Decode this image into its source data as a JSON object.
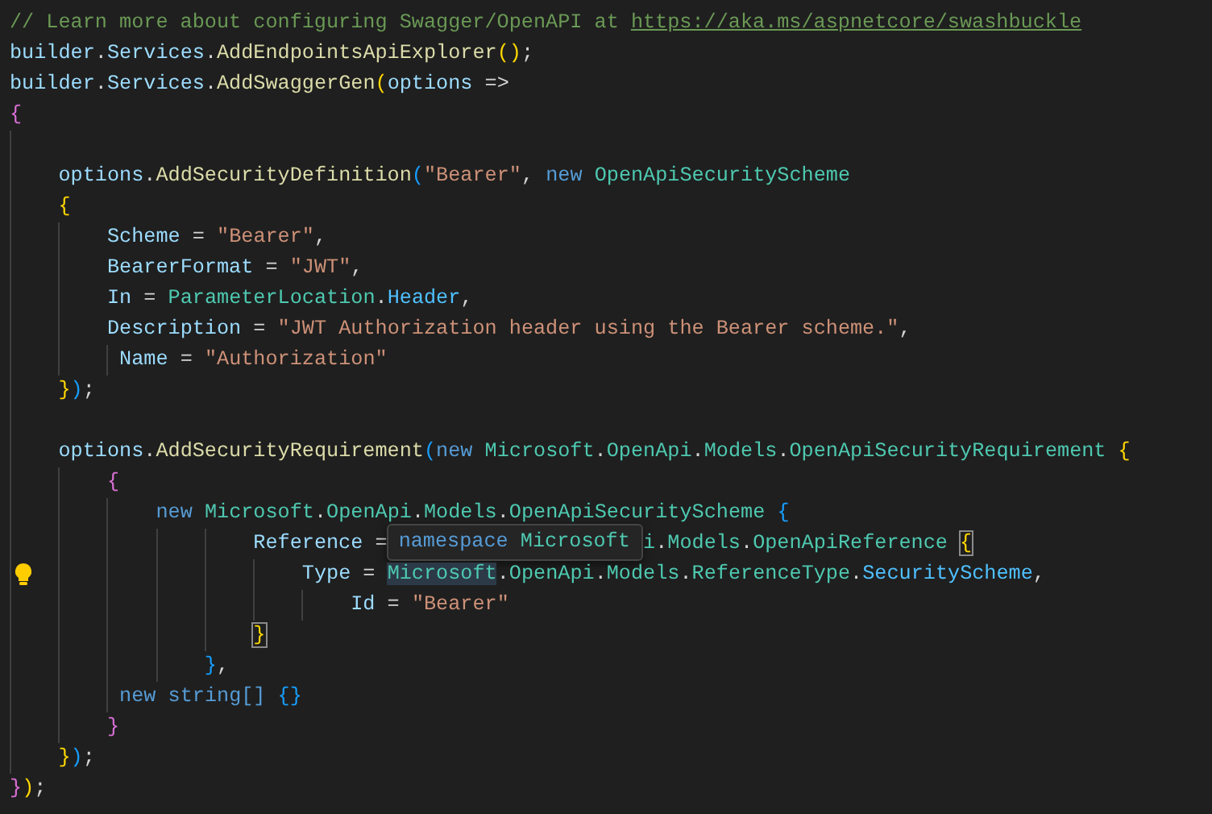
{
  "editor": {
    "lines": [
      {
        "kind": "code",
        "segments": [
          {
            "kind": "code",
            "tokens": [
              {
                "text": "// Learn more about configuring Swagger/OpenAPI at",
                "kind": "comment"
              }
            ]
          },
          {
            "kind": "link",
            "tokens": [
              {
                "text": "https://aka.ms/aspnetcore/swashbuckle",
                "kind": "link"
              }
            ]
          }
        ]
      },
      {
        "kind": "code",
        "segments": [
          {
            "kind": "code",
            "tokens": [
              {
                "text": "builder",
                "kind": "var"
              },
              {
                "text": ".",
                "kind": "p"
              },
              {
                "text": "Services",
                "kind": "var"
              },
              {
                "text": ".",
                "kind": "p"
              },
              {
                "text": "AddEndpointsApiExplorer",
                "kind": "fn"
              },
              {
                "text": "()",
                "kind": "b1"
              },
              {
                "text": ";",
                "kind": "p"
              }
            ]
          }
        ]
      },
      {
        "kind": "code",
        "segments": [
          {
            "kind": "code",
            "tokens": [
              {
                "text": "builder",
                "kind": "var"
              },
              {
                "text": ".",
                "kind": "p"
              },
              {
                "text": "Services",
                "kind": "var"
              },
              {
                "text": ".",
                "kind": "p"
              },
              {
                "text": "AddSwaggerGen",
                "kind": "fn"
              },
              {
                "text": "(",
                "kind": "b1"
              },
              {
                "text": "options",
                "kind": "var"
              },
              {
                "text": " =>",
                "kind": "p"
              }
            ]
          }
        ]
      },
      {
        "kind": "code",
        "segments": [
          {
            "kind": "code",
            "tokens": [
              {
                "text": "{",
                "kind": "b2"
              }
            ]
          }
        ]
      },
      {
        "kind": "blank"
      },
      {
        "kind": "code",
        "segments": [
          {
            "kind": "code",
            "tokens": [
              {
                "text": "    options",
                "kind": "var"
              },
              {
                "text": ".",
                "kind": "p"
              },
              {
                "text": "AddSecurityDefinition",
                "kind": "fn"
              },
              {
                "text": "(",
                "kind": "b3"
              },
              {
                "text": "\"Bearer\"",
                "kind": "str"
              },
              {
                "text": ", ",
                "kind": "p"
              },
              {
                "text": "new",
                "kind": "kw"
              },
              {
                "text": " OpenApiSecurityScheme",
                "kind": "type"
              }
            ]
          }
        ]
      },
      {
        "kind": "code",
        "segments": [
          {
            "kind": "code",
            "tokens": [
              {
                "text": "    {",
                "kind": "b1"
              }
            ]
          }
        ]
      },
      {
        "kind": "code",
        "segments": [
          {
            "kind": "code",
            "tokens": [
              {
                "text": "        Scheme",
                "kind": "var"
              },
              {
                "text": " = ",
                "kind": "p"
              },
              {
                "text": "\"Bearer\"",
                "kind": "str"
              },
              {
                "text": ",",
                "kind": "p"
              }
            ]
          }
        ]
      },
      {
        "kind": "code",
        "segments": [
          {
            "kind": "code",
            "tokens": [
              {
                "text": "        BearerFormat",
                "kind": "var"
              },
              {
                "text": " = ",
                "kind": "p"
              },
              {
                "text": "\"JWT\"",
                "kind": "str"
              },
              {
                "text": ",",
                "kind": "p"
              }
            ]
          }
        ]
      },
      {
        "kind": "code",
        "segments": [
          {
            "kind": "code",
            "tokens": [
              {
                "text": "        In",
                "kind": "var"
              },
              {
                "text": " = ",
                "kind": "p"
              },
              {
                "text": "ParameterLocation",
                "kind": "type"
              },
              {
                "text": ".",
                "kind": "p"
              },
              {
                "text": "Header",
                "kind": "enum"
              },
              {
                "text": ",",
                "kind": "p"
              }
            ]
          }
        ]
      },
      {
        "kind": "code",
        "segments": [
          {
            "kind": "code",
            "tokens": [
              {
                "text": "        Description",
                "kind": "var"
              },
              {
                "text": " = ",
                "kind": "p"
              },
              {
                "text": "\"JWT Authorization header using the Bearer scheme.\"",
                "kind": "str"
              },
              {
                "text": ",",
                "kind": "p"
              }
            ]
          }
        ]
      },
      {
        "kind": "code",
        "segments": [
          {
            "kind": "code",
            "tokens": [
              {
                "text": "         Name",
                "kind": "var"
              },
              {
                "text": " = ",
                "kind": "p"
              },
              {
                "text": "\"Authorization\"",
                "kind": "str"
              }
            ]
          }
        ]
      },
      {
        "kind": "code",
        "segments": [
          {
            "kind": "code",
            "tokens": [
              {
                "text": "    }",
                "kind": "b1"
              },
              {
                "text": ")",
                "kind": "b3"
              },
              {
                "text": ";",
                "kind": "p"
              }
            ]
          }
        ]
      },
      {
        "kind": "blank"
      },
      {
        "kind": "code",
        "segments": [
          {
            "kind": "code",
            "tokens": [
              {
                "text": "    options",
                "kind": "var"
              },
              {
                "text": ".",
                "kind": "p"
              },
              {
                "text": "AddSecurityRequirement",
                "kind": "fn"
              },
              {
                "text": "(",
                "kind": "b3"
              },
              {
                "text": "new",
                "kind": "kw"
              },
              {
                "text": " Microsoft",
                "kind": "type"
              },
              {
                "text": ".",
                "kind": "p"
              },
              {
                "text": "OpenApi",
                "kind": "type"
              },
              {
                "text": ".",
                "kind": "p"
              },
              {
                "text": "Models",
                "kind": "type"
              },
              {
                "text": ".",
                "kind": "p"
              },
              {
                "text": "OpenApiSecurityRequirement",
                "kind": "type"
              },
              {
                "text": " {",
                "kind": "b1"
              }
            ]
          }
        ]
      },
      {
        "kind": "code",
        "segments": [
          {
            "kind": "code",
            "tokens": [
              {
                "text": "        {",
                "kind": "b2"
              }
            ]
          }
        ]
      },
      {
        "kind": "code",
        "segments": [
          {
            "kind": "code",
            "tokens": [
              {
                "text": "            new",
                "kind": "kw"
              },
              {
                "text": " Microsoft",
                "kind": "type"
              },
              {
                "text": ".",
                "kind": "p"
              },
              {
                "text": "OpenApi",
                "kind": "type"
              },
              {
                "text": ".",
                "kind": "p"
              },
              {
                "text": "Models",
                "kind": "type"
              },
              {
                "text": ".",
                "kind": "p"
              },
              {
                "text": "OpenApiSecurityScheme",
                "kind": "type"
              },
              {
                "text": " {",
                "kind": "b3"
              }
            ]
          }
        ]
      },
      {
        "kind": "code",
        "segments": [
          {
            "kind": "code",
            "tokens": [
              {
                "text": "                    Reference",
                "kind": "var"
              },
              {
                "text": " =",
                "kind": "p"
              }
            ]
          },
          {
            "kind": "tooltip",
            "tokens": [
              {
                "text": "namespace",
                "kind": "kw"
              },
              {
                "text": " Microsoft",
                "kind": "type"
              }
            ]
          },
          {
            "kind": "code",
            "tokens": [
              {
                "text": "i",
                "kind": "type"
              },
              {
                "text": ".",
                "kind": "p"
              },
              {
                "text": "Models",
                "kind": "type"
              },
              {
                "text": ".",
                "kind": "p"
              },
              {
                "text": "OpenApiReference ",
                "kind": "type"
              },
              {
                "text": "{",
                "kind": "bmatch"
              }
            ]
          }
        ]
      },
      {
        "kind": "code",
        "lightbulb": true,
        "segments": [
          {
            "kind": "code",
            "tokens": [
              {
                "text": "                        Type",
                "kind": "var"
              },
              {
                "text": " = ",
                "kind": "p"
              },
              {
                "text": "Microsoft",
                "kind": "hover"
              },
              {
                "text": ".",
                "kind": "p"
              },
              {
                "text": "OpenApi",
                "kind": "type"
              },
              {
                "text": ".",
                "kind": "p"
              },
              {
                "text": "Models",
                "kind": "type"
              },
              {
                "text": ".",
                "kind": "p"
              },
              {
                "text": "ReferenceType",
                "kind": "type"
              },
              {
                "text": ".",
                "kind": "p"
              },
              {
                "text": "SecurityScheme",
                "kind": "enum"
              },
              {
                "text": ",",
                "kind": "p"
              }
            ]
          }
        ]
      },
      {
        "kind": "code",
        "segments": [
          {
            "kind": "code",
            "tokens": [
              {
                "text": "                            Id",
                "kind": "var"
              },
              {
                "text": " = ",
                "kind": "p"
              },
              {
                "text": "\"Bearer\"",
                "kind": "str"
              }
            ]
          }
        ]
      },
      {
        "kind": "code",
        "segments": [
          {
            "kind": "code",
            "tokens": [
              {
                "text": "                    }",
                "kind": "bmatch"
              }
            ]
          }
        ]
      },
      {
        "kind": "code",
        "segments": [
          {
            "kind": "code",
            "tokens": [
              {
                "text": "                }",
                "kind": "b3"
              },
              {
                "text": ",",
                "kind": "p"
              }
            ]
          }
        ]
      },
      {
        "kind": "code",
        "segments": [
          {
            "kind": "code",
            "tokens": [
              {
                "text": "         new",
                "kind": "kw"
              },
              {
                "text": " string[]",
                "kind": "kw"
              },
              {
                "text": " {}",
                "kind": "b3"
              }
            ]
          }
        ]
      },
      {
        "kind": "code",
        "segments": [
          {
            "kind": "code",
            "tokens": [
              {
                "text": "        }",
                "kind": "b2"
              }
            ]
          }
        ]
      },
      {
        "kind": "code",
        "segments": [
          {
            "kind": "code",
            "tokens": [
              {
                "text": "    }",
                "kind": "b1"
              },
              {
                "text": ")",
                "kind": "b3"
              },
              {
                "text": ";",
                "kind": "p"
              }
            ]
          }
        ]
      },
      {
        "kind": "code",
        "segments": [
          {
            "kind": "code",
            "tokens": [
              {
                "text": "}",
                "kind": "b2"
              },
              {
                "text": ")",
                "kind": "b1"
              },
              {
                "text": ";",
                "kind": "p"
              }
            ]
          }
        ]
      }
    ]
  }
}
